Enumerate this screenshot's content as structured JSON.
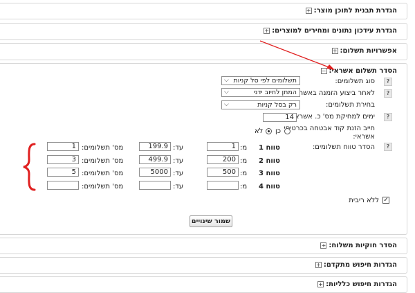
{
  "sections": {
    "product_template": "הגדרת תבנית לתוכן מוצר:",
    "update_stock_prices": "הגדרת עידכון נתונים ומחירים למוצרים:",
    "payment_options": "אפשרויות תשלום:",
    "installments_config": "הסדר תשלום אשראי:",
    "shipping_rules": "הסדר חוקיות משלוח:",
    "advanced_search": "הגדרות חיפוש מתקדם:",
    "general_search": "הגדרות חיפוש כלליות:"
  },
  "form": {
    "payment_type_label": "סוג תשלומים:",
    "payment_type_value": "תשלומים לפי סל קניות",
    "after_order_label": "לאחר ביצוע הזמנה באשראי:",
    "after_order_value": "המתן לחיוב ידני",
    "choice_label": "בחירת תשלומים:",
    "choice_value": "רק בסל קניות",
    "days_label": "ימים למחיקת מס' כ. אשראי:",
    "days_value": "14",
    "cvv_label_line1": "חייב הזנת קוד אבטחה בכרטיסי",
    "cvv_label_line2": "אשראי:",
    "yes_label": "כן",
    "no_label": "לא",
    "tiers_label": "הסדר טווח תשלומים:",
    "from_label": "מ:",
    "to_label": "עד:",
    "count_label": "מס' תשלומים:",
    "no_interest_label": "ללא ריבית",
    "save_button": "שמור שינויים"
  },
  "tiers": [
    {
      "name": "טווח 1",
      "from": "1",
      "to": "199.9",
      "count": "1"
    },
    {
      "name": "טווח 2",
      "from": "200",
      "to": "499.9",
      "count": "3"
    },
    {
      "name": "טווח 3",
      "from": "500",
      "to": "5000",
      "count": "5"
    },
    {
      "name": "טווח 4",
      "from": "",
      "to": "",
      "count": ""
    }
  ],
  "icons": {
    "help": "?",
    "expand": "+",
    "collapse": "−",
    "chevron": "⌵",
    "check": "✓"
  },
  "colors": {
    "annotation_red": "#e02020",
    "panel_border": "#d6d6d6"
  }
}
